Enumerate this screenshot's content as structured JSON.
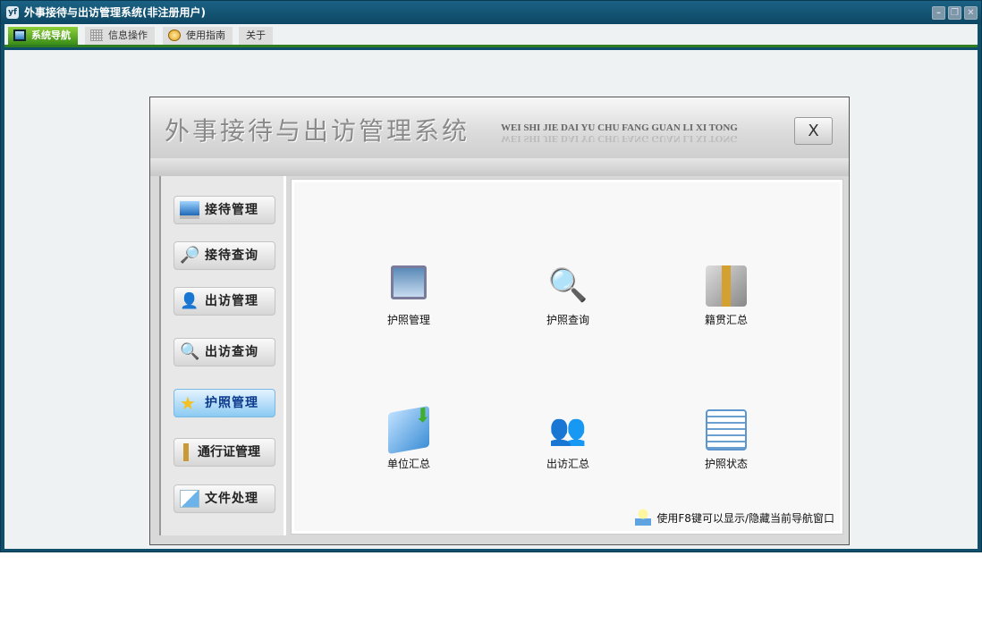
{
  "window": {
    "title": "外事接待与出访管理系统(非注册用户)",
    "controls": [
      "minimize",
      "restore",
      "close"
    ]
  },
  "tabs": [
    {
      "label": "系统导航",
      "icon": "monitor-icon",
      "active": true
    },
    {
      "label": "信息操作",
      "icon": "grid-icon"
    },
    {
      "label": "使用指南",
      "icon": "help-icon"
    },
    {
      "label": "关于"
    }
  ],
  "panel": {
    "title": "外事接待与出访管理系统",
    "pinyin": "WEI SHI JIE DAI YU CHU FANG GUAN  LI  XI  TONG",
    "close_label": "X"
  },
  "nav": [
    {
      "label": "接待管理",
      "icon": "monitor-icon"
    },
    {
      "label": "接待查询",
      "icon": "magnifier-icon"
    },
    {
      "label": "出访管理",
      "icon": "person-icon"
    },
    {
      "label": "出访查询",
      "icon": "search-icon"
    },
    {
      "label": "护照管理",
      "icon": "star-icon",
      "selected": true
    },
    {
      "label": "通行证管理",
      "icon": "figure-icon"
    },
    {
      "label": "文件处理",
      "icon": "document-icon"
    }
  ],
  "items": [
    {
      "label": "护照管理",
      "icon": "computer-icon"
    },
    {
      "label": "护照查询",
      "icon": "search-monitor-icon"
    },
    {
      "label": "籍贯汇总",
      "icon": "figure-icon"
    },
    {
      "label": "单位汇总",
      "icon": "book-download-icon"
    },
    {
      "label": "出访汇总",
      "icon": "users-icon"
    },
    {
      "label": "护照状态",
      "icon": "settings-doc-icon"
    }
  ],
  "hint": "使用F8键可以显示/隐藏当前导航窗口"
}
